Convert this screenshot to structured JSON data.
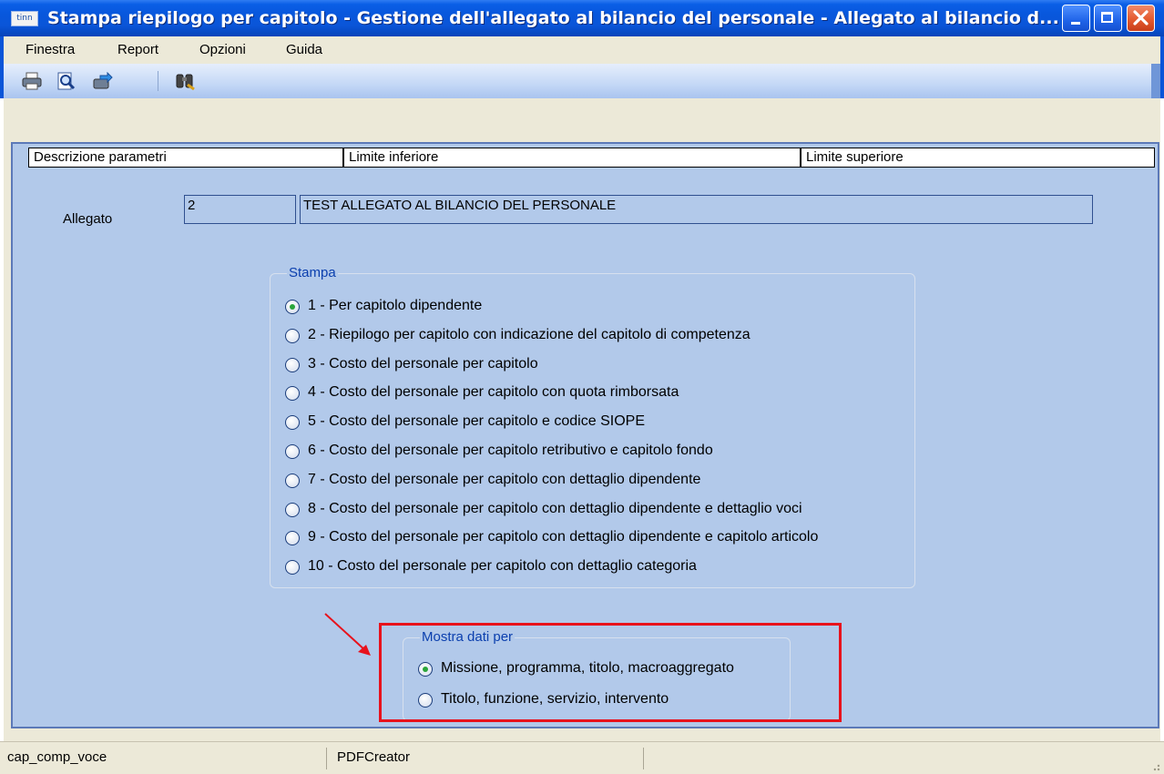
{
  "window": {
    "app_icon": "tinn",
    "title": "Stampa riepilogo per capitolo - Gestione dell'allegato al bilancio del personale - Allegato al bilancio d..."
  },
  "menu": [
    "Finestra",
    "Report",
    "Opzioni",
    "Guida"
  ],
  "toolbar": {
    "icons": [
      "print-icon",
      "print-preview-icon",
      "export-icon",
      "find-icon"
    ]
  },
  "grid_headers": [
    "Descrizione parametri",
    "Limite inferiore",
    "Limite superiore"
  ],
  "allegato": {
    "label": "Allegato",
    "code": "2",
    "description": "TEST ALLEGATO AL BILANCIO DEL PERSONALE"
  },
  "stampa": {
    "legend": "Stampa",
    "selected": 0,
    "options": [
      "1 - Per capitolo dipendente",
      "2 - Riepilogo per capitolo con indicazione del capitolo di competenza",
      "3 - Costo del personale per capitolo",
      "4 - Costo del personale per capitolo con quota rimborsata",
      "5 - Costo del personale per capitolo e codice SIOPE",
      "6 - Costo del personale per capitolo retributivo e capitolo fondo",
      "7 - Costo del personale per capitolo con dettaglio dipendente",
      "8 - Costo del personale per capitolo con dettaglio dipendente e dettaglio voci",
      "9 - Costo del personale per capitolo con dettaglio dipendente e capitolo articolo",
      "10 - Costo del personale per capitolo con dettaglio categoria"
    ]
  },
  "mostra": {
    "legend": "Mostra dati per",
    "selected": 0,
    "options": [
      "Missione, programma, titolo, macroaggregato",
      "Titolo, funzione, servizio, intervento"
    ]
  },
  "statusbar": [
    "cap_comp_voce",
    "PDFCreator"
  ],
  "colors": {
    "panel_bg": "#b2c9ea",
    "highlight": "#e8121c",
    "legend_text": "#0b3fae",
    "title_bar": "#0857dc"
  }
}
